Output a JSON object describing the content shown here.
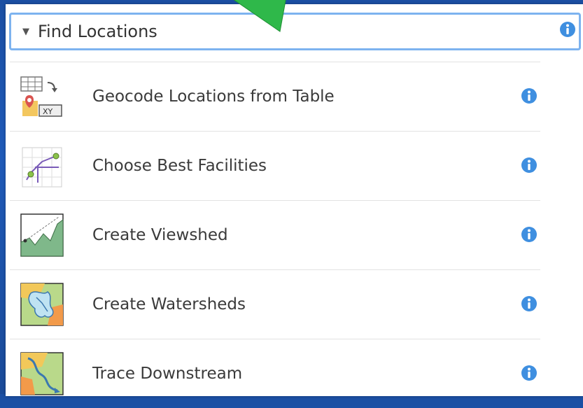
{
  "panel": {
    "header": {
      "title": "Find Locations",
      "caret_icon": "caret-down-icon",
      "info_icon": "info-icon"
    },
    "tools": [
      {
        "label": "Geocode Locations from Table",
        "icon": "geocode-table-icon"
      },
      {
        "label": "Choose Best Facilities",
        "icon": "best-facilities-icon"
      },
      {
        "label": "Create Viewshed",
        "icon": "viewshed-icon"
      },
      {
        "label": "Create Watersheds",
        "icon": "watersheds-icon"
      },
      {
        "label": "Trace Downstream",
        "icon": "trace-downstream-icon"
      }
    ]
  },
  "colors": {
    "background": "#1f5ab8",
    "header_border": "#7db3ef",
    "info": "#3f8fe0",
    "pointer": "#2fbf4a"
  }
}
